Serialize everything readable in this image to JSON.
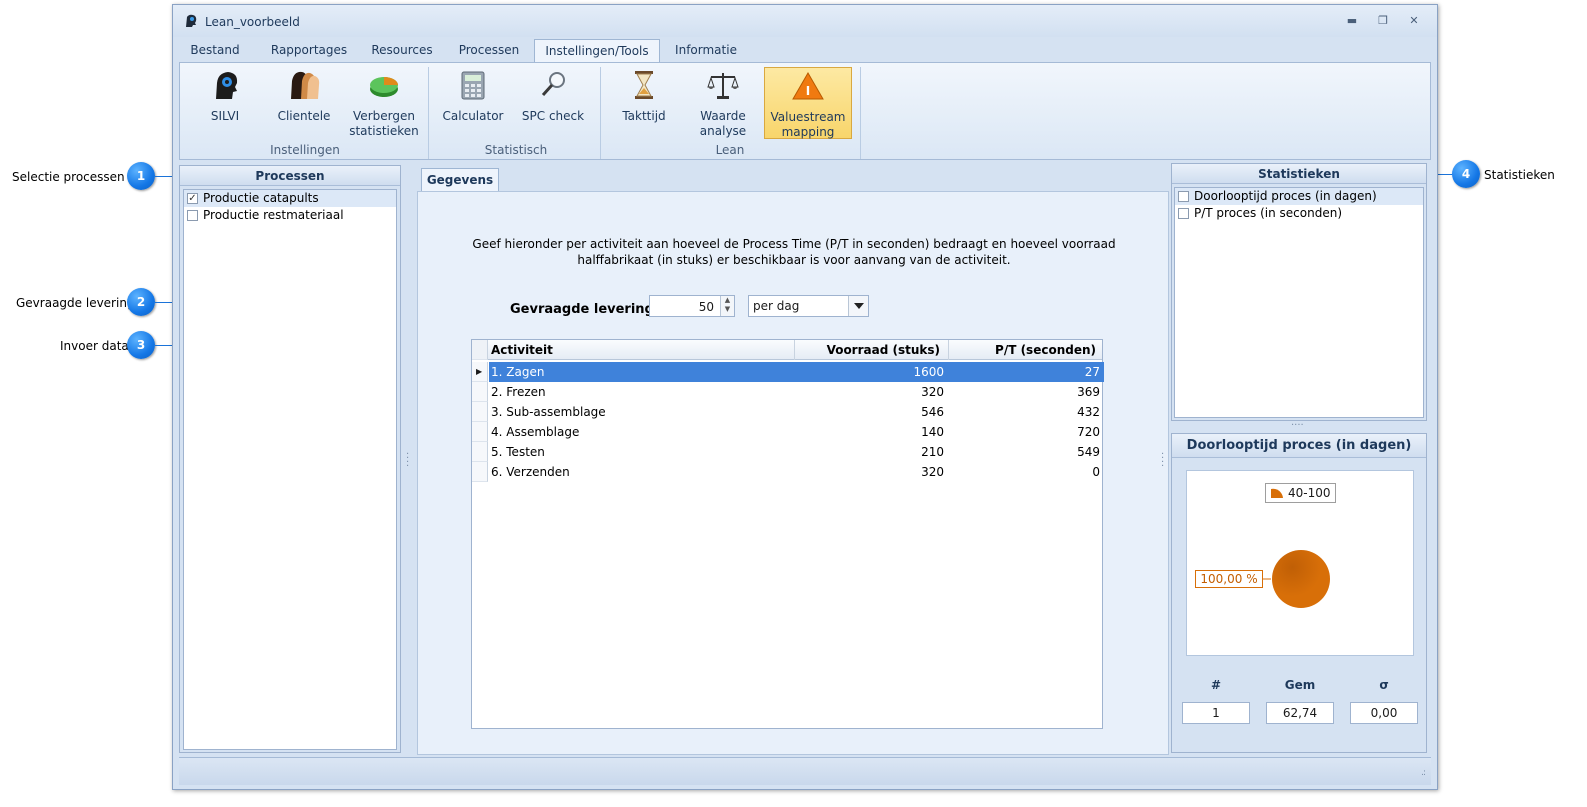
{
  "callouts": [
    {
      "num": "1",
      "label": "Selectie processen"
    },
    {
      "num": "2",
      "label": "Gevraagde levering"
    },
    {
      "num": "3",
      "label": "Invoer data"
    },
    {
      "num": "4",
      "label": "Statistieken"
    }
  ],
  "window": {
    "title": "Lean_voorbeeld",
    "controls": {
      "minimize": "▬",
      "restore": "❐",
      "close": "✕"
    }
  },
  "menu_tabs": [
    "Bestand",
    "Rapportages",
    "Resources",
    "Processen",
    "Instellingen/Tools",
    "Informatie"
  ],
  "active_menu_tab": "Instellingen/Tools",
  "ribbon": {
    "groups": [
      {
        "label": "Instellingen",
        "buttons": [
          {
            "label": "SILVI",
            "icon": "head-gear-icon"
          },
          {
            "label": "Clientele",
            "icon": "people-icon"
          },
          {
            "label": "Verbergen statistieken",
            "label_lines": [
              "Verbergen",
              "statistieken"
            ],
            "icon": "pie-chart-icon"
          }
        ]
      },
      {
        "label": "Statistisch",
        "buttons": [
          {
            "label": "Calculator",
            "icon": "calculator-icon"
          },
          {
            "label": "SPC check",
            "icon": "magnifier-icon"
          }
        ]
      },
      {
        "label": "Lean",
        "buttons": [
          {
            "label": "Takttijd",
            "icon": "hourglass-icon"
          },
          {
            "label": "Waarde analyse",
            "label_lines": [
              "Waarde",
              "analyse"
            ],
            "icon": "scales-icon"
          },
          {
            "label": "Valuestream mapping",
            "label_lines": [
              "Valuestream",
              "mapping"
            ],
            "icon": "warning-triangle-icon",
            "selected": true
          }
        ]
      }
    ]
  },
  "processen_panel": {
    "title": "Processen",
    "items": [
      {
        "label": "Productie catapults",
        "checked": true
      },
      {
        "label": "Productie restmateriaal",
        "checked": false
      }
    ]
  },
  "content": {
    "tab_label": "Gegevens",
    "description_line1": "Geef hieronder per activiteit aan hoeveel de Process Time (P/T in seconden) bedraagt en hoeveel voorraad",
    "description_line2": "halffabrikaat (in stuks) er beschikbaar is voor aanvang van de activiteit.",
    "levering_label": "Gevraagde levering",
    "levering_value": "50",
    "period_value": "per dag",
    "grid": {
      "columns": [
        "Activiteit",
        "Voorraad (stuks)",
        "P/T (seconden)"
      ],
      "rows": [
        [
          "1. Zagen",
          "1600",
          "27"
        ],
        [
          "2. Frezen",
          "320",
          "369"
        ],
        [
          "3. Sub-assemblage",
          "546",
          "432"
        ],
        [
          "4. Assemblage",
          "140",
          "720"
        ],
        [
          "5. Testen",
          "210",
          "549"
        ],
        [
          "6. Verzenden",
          "320",
          "0"
        ]
      ]
    }
  },
  "stats_panel": {
    "title": "Statistieken",
    "items": [
      {
        "label": "Doorlooptijd proces (in dagen)",
        "checked": false
      },
      {
        "label": "P/T proces (in seconden)",
        "checked": false
      }
    ]
  },
  "chart_panel": {
    "title": "Doorlooptijd proces (in dagen)",
    "chart_data": {
      "type": "pie",
      "categories": [
        "40-100"
      ],
      "values": [
        100
      ],
      "slice_labels": [
        "100,00 %"
      ],
      "legend": "top",
      "colors": [
        "#d86f08"
      ]
    },
    "stats": [
      {
        "label": "#",
        "value": "1"
      },
      {
        "label": "Gem",
        "value": "62,74"
      },
      {
        "label": "σ",
        "value": "0,00"
      }
    ]
  },
  "colors": {
    "accent_blue": "#1477e6",
    "selection": "#3f82da",
    "pie": "#d86f08",
    "ribbon_selected": "#f8d56b"
  }
}
